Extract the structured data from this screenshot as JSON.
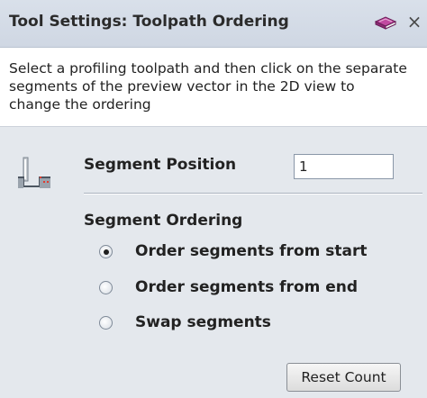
{
  "window": {
    "title": "Tool Settings: Toolpath Ordering",
    "help_icon": "book-icon",
    "close_icon": "close-icon",
    "close_glyph": "×"
  },
  "description": "Select a profiling toolpath and then click on the separate\nsegments of the preview vector in the 2D view to\nchange the ordering",
  "segment_position": {
    "label": "Segment Position",
    "value": "1"
  },
  "segment_ordering": {
    "label": "Segment Ordering",
    "options": [
      {
        "label": "Order segments from start",
        "checked": true
      },
      {
        "label": "Order segments from end",
        "checked": false
      },
      {
        "label": "Swap segments",
        "checked": false
      }
    ]
  },
  "buttons": {
    "reset_count": "Reset Count"
  },
  "colors": {
    "titlebar": "#d3dae5",
    "content_bg": "#e4e8ed",
    "book_icon": "#b0388c"
  }
}
